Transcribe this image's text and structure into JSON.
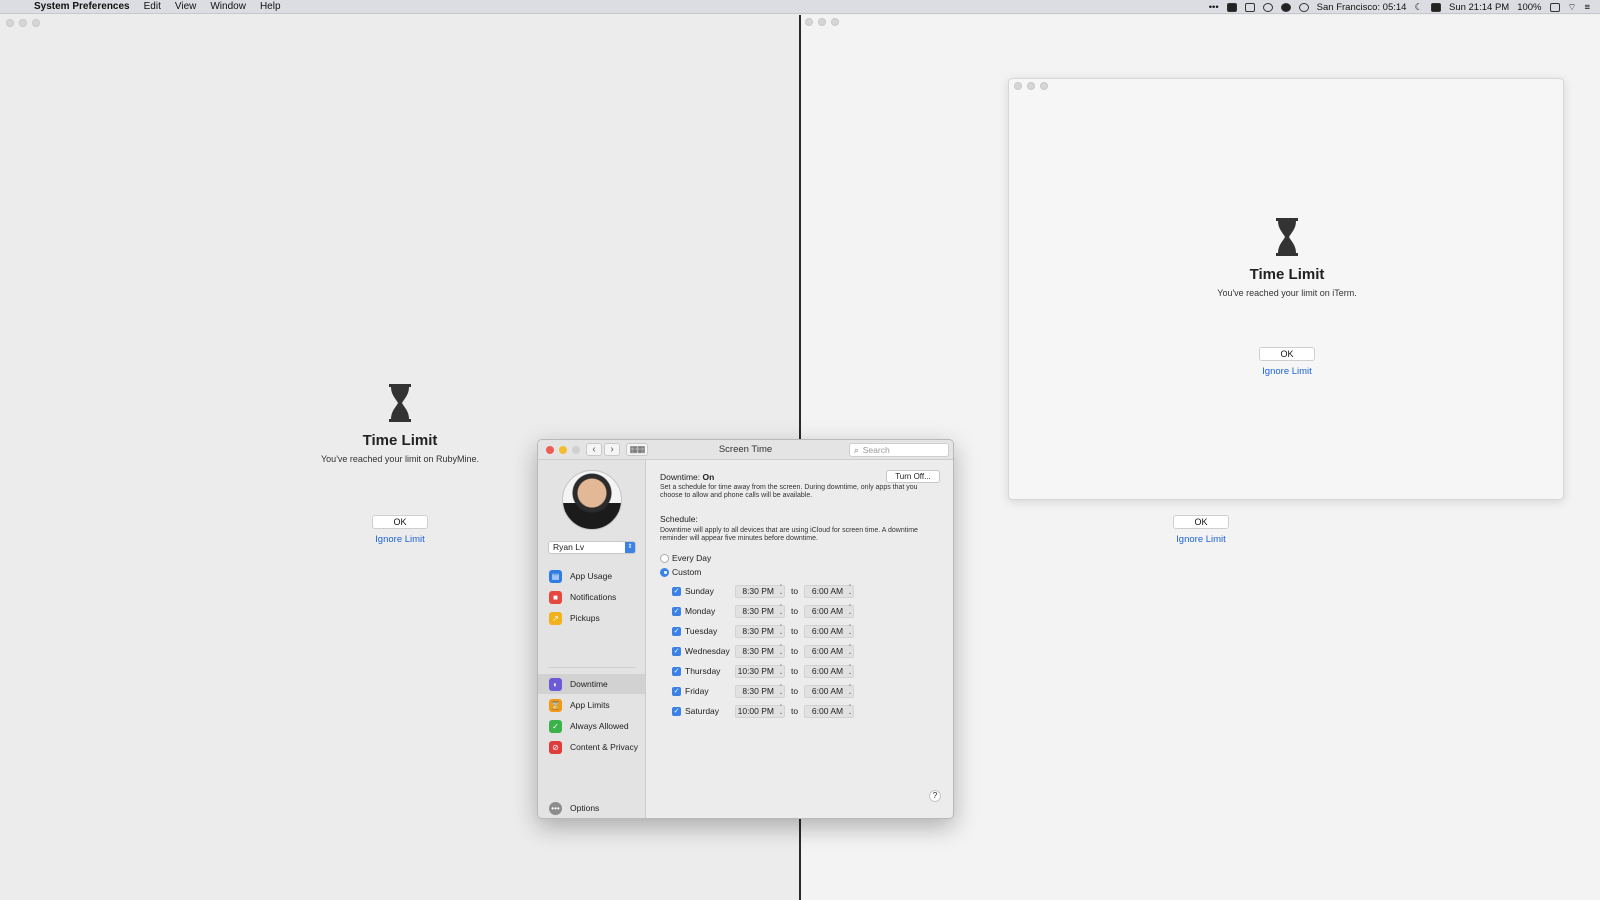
{
  "menubar": {
    "app_name": "System Preferences",
    "items": [
      "Edit",
      "View",
      "Window",
      "Help"
    ],
    "status": {
      "clock_city": "San Francisco: 05:14",
      "date_time": "Sun 21:14 PM",
      "battery": "100%"
    }
  },
  "left_pane": {
    "time_limit": {
      "title": "Time Limit",
      "message": "You've reached your limit on RubyMine.",
      "ok": "OK",
      "ignore": "Ignore Limit"
    }
  },
  "right_pane": {
    "behind": {
      "ok": "OK",
      "ignore": "Ignore Limit"
    },
    "iterm_window": {
      "title": "Time Limit",
      "message": "You've reached your limit on iTerm.",
      "ok": "OK",
      "ignore": "Ignore Limit"
    }
  },
  "screen_time": {
    "window_title": "Screen Time",
    "search_placeholder": "Search",
    "user": "Ryan Lv",
    "sidebar": {
      "app_usage": "App Usage",
      "notifications": "Notifications",
      "pickups": "Pickups",
      "downtime": "Downtime",
      "app_limits": "App Limits",
      "always_allowed": "Always Allowed",
      "content_privacy": "Content & Privacy",
      "options": "Options"
    },
    "downtime_label": "Downtime:",
    "downtime_status": "On",
    "turn_off": "Turn Off...",
    "description": "Set a schedule for time away from the screen. During downtime, only apps that you choose to allow and phone calls will be available.",
    "schedule_label": "Schedule:",
    "schedule_note": "Downtime will apply to all devices that are using iCloud for screen time. A downtime reminder will appear five minutes before downtime.",
    "every_day": "Every Day",
    "custom": "Custom",
    "to": "to",
    "days": [
      {
        "name": "Sunday",
        "start": "8:30 PM",
        "end": "6:00 AM"
      },
      {
        "name": "Monday",
        "start": "8:30 PM",
        "end": "6:00 AM"
      },
      {
        "name": "Tuesday",
        "start": "8:30 PM",
        "end": "6:00 AM"
      },
      {
        "name": "Wednesday",
        "start": "8:30 PM",
        "end": "6:00 AM"
      },
      {
        "name": "Thursday",
        "start": "10:30 PM",
        "end": "6:00 AM"
      },
      {
        "name": "Friday",
        "start": "8:30 PM",
        "end": "6:00 AM"
      },
      {
        "name": "Saturday",
        "start": "10:00 PM",
        "end": "6:00 AM"
      }
    ],
    "help": "?"
  }
}
